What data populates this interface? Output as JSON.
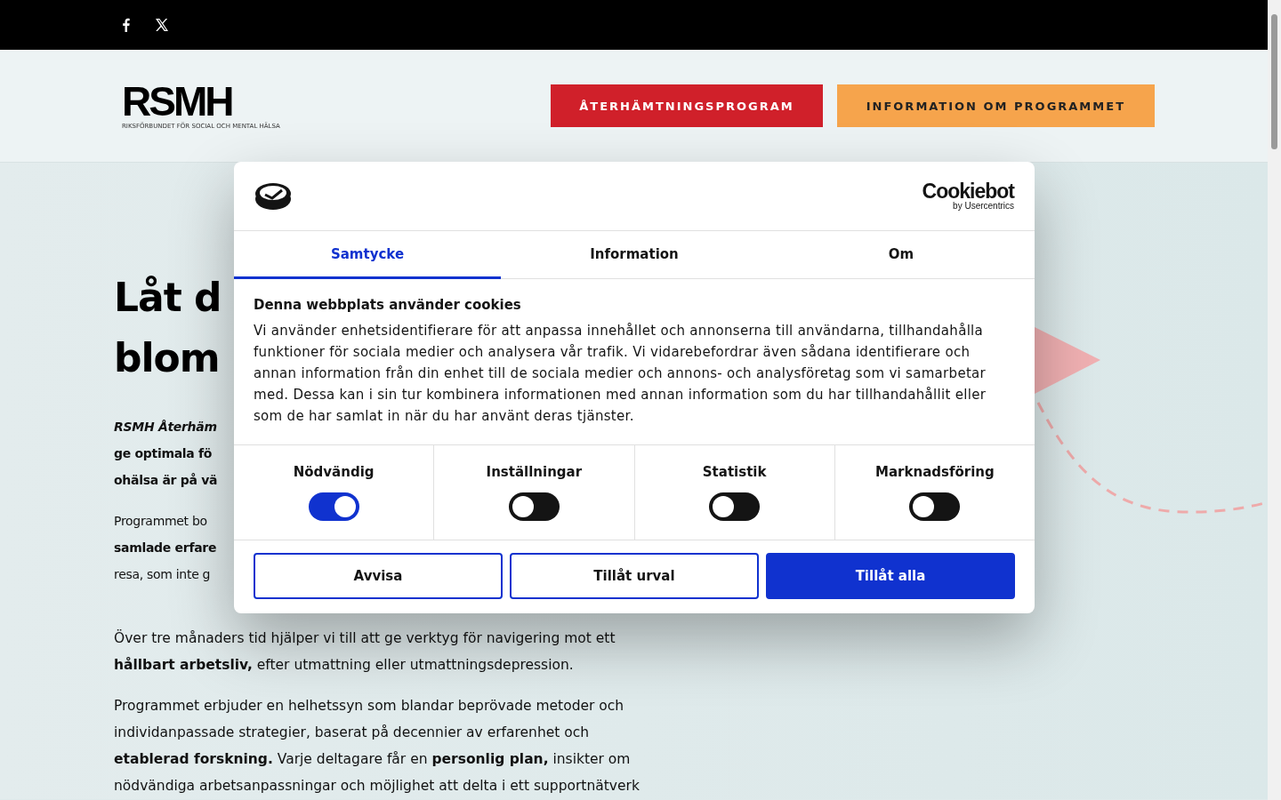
{
  "logo": {
    "name": "RSMH",
    "tagline": "RIKSFÖRBUNDET FÖR SOCIAL OCH MENTAL HÄLSA"
  },
  "nav_buttons": [
    {
      "label": "ÅTERHÄMTNINGSPROGRAM",
      "kind": "primary"
    },
    {
      "label": "INFORMATION OM PROGRAMMET",
      "kind": "secondary"
    }
  ],
  "hero": {
    "heading_lines": [
      "Låt d",
      "blom"
    ],
    "paragraphs": [
      {
        "kind": "lead",
        "lines": [
          "*RSMH Återhäm*",
          "ge optimala fö",
          "ohälsa är på vä"
        ]
      },
      {
        "kind": "body",
        "lines": [
          "Programmet bo",
          "**samlade erfare**",
          "resa, som inte g"
        ]
      },
      {
        "kind": "body",
        "lines": [
          "Över tre månaders tid hjälper vi till att ge verktyg för navigering mot ett",
          "**hållbart arbetsliv,** efter utmattning eller utmattningsdepression."
        ]
      },
      {
        "kind": "body",
        "lines": [
          "Programmet erbjuder en helhetssyn som blandar beprövade metoder och",
          "individanpassade strategier, baserat på decennier av erfarenhet och",
          "**etablerad forskning.** Varje deltagare får en **personlig plan,** insikter om",
          "nödvändiga arbetsanpassningar och möjlighet att delta i ett supportnätverk"
        ]
      }
    ]
  },
  "cookie_dialog": {
    "brand": "Cookiebot",
    "brand_sub": "by Usercentrics",
    "tabs": [
      {
        "label": "Samtycke",
        "selected": true
      },
      {
        "label": "Information",
        "selected": false
      },
      {
        "label": "Om",
        "selected": false
      }
    ],
    "title": "Denna webbplats använder cookies",
    "text": "Vi använder enhetsidentifierare för att anpassa innehållet och annonserna till användarna, tillhandahålla funktioner för sociala medier och analysera vår trafik. Vi vidarebefordrar även sådana identifierare och annan information från din enhet till de sociala medier och annons- och analysföretag som vi samarbetar med. Dessa kan i sin tur kombinera informationen med annan information som du har tillhandahållit eller som de har samlat in när du har använt deras tjänster.",
    "categories": [
      {
        "label": "Nödvändig",
        "on": true
      },
      {
        "label": "Inställningar",
        "on": false
      },
      {
        "label": "Statistik",
        "on": false
      },
      {
        "label": "Marknadsföring",
        "on": false
      }
    ],
    "buttons": [
      {
        "label": "Avvisa",
        "kind": "outline"
      },
      {
        "label": "Tillåt urval",
        "kind": "outline"
      },
      {
        "label": "Tillåt alla",
        "kind": "filled"
      }
    ]
  }
}
